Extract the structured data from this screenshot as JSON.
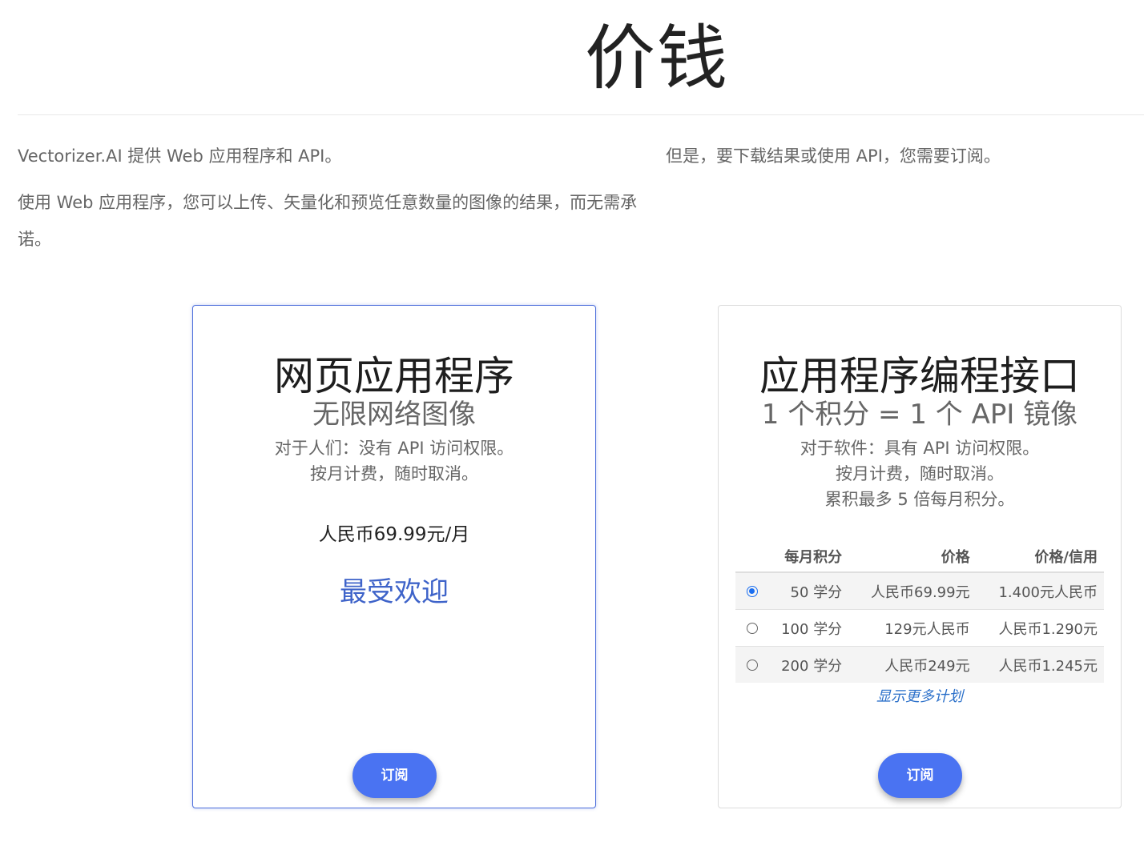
{
  "page": {
    "title": "价钱"
  },
  "intro": {
    "left_p1": "Vectorizer.AI 提供 Web 应用程序和 API。",
    "left_p2": "使用 Web 应用程序，您可以上传、矢量化和预览任意数量的图像的结果，而无需承诺。",
    "right_p1": "但是，要下载结果或使用 API，您需要订阅。"
  },
  "web_app": {
    "title": "网页应用程序",
    "subtitle": "无限网络图像",
    "desc_line1": "对于人们：没有 API 访问权限。",
    "desc_line2": "按月计费，随时取消。",
    "price": "人民币69.99元/月",
    "badge": "最受欢迎",
    "subscribe_label": "订阅"
  },
  "api": {
    "title": "应用程序编程接口",
    "subtitle": "1 个积分 = 1 个 API 镜像",
    "desc_line1": "对于软件：具有 API 访问权限。",
    "desc_line2": "按月计费，随时取消。",
    "desc_line3": "累积最多 5 倍每月积分。",
    "table_headers": [
      "每月积分",
      "价格",
      "价格/信用"
    ],
    "plans": [
      {
        "credits": "50 学分",
        "price": "人民币69.99元",
        "per_credit": "1.400元人民币",
        "selected": true
      },
      {
        "credits": "100 学分",
        "price": "129元人民币",
        "per_credit": "人民币1.290元",
        "selected": false
      },
      {
        "credits": "200 学分",
        "price": "人民币249元",
        "per_credit": "人民币1.245元",
        "selected": false
      }
    ],
    "more_plans_label": "显示更多计划",
    "subscribe_label": "订阅"
  }
}
